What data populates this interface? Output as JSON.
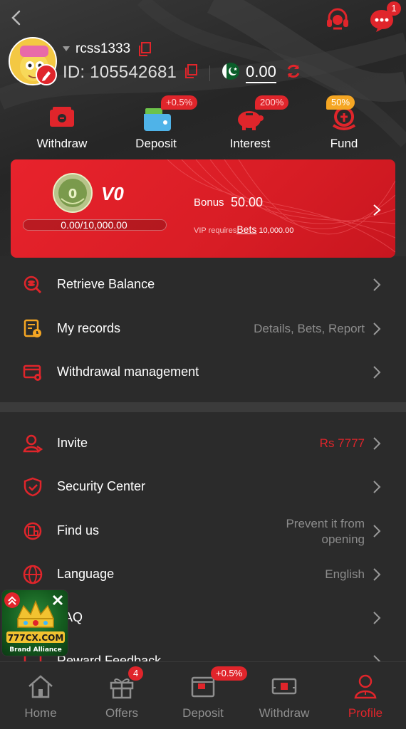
{
  "header": {
    "username": "rcss1333",
    "id_label": "ID:",
    "id_value": "105542681",
    "balance": "0.00",
    "message_count": "1"
  },
  "quick_actions": [
    {
      "label": "Withdraw",
      "badge": "",
      "icon": "withdraw-icon"
    },
    {
      "label": "Deposit",
      "badge": "+0.5%",
      "icon": "wallet-icon"
    },
    {
      "label": "Interest",
      "badge": "200%",
      "icon": "piggy-bank-icon"
    },
    {
      "label": "Fund",
      "badge": "50%",
      "icon": "fund-icon"
    }
  ],
  "vip": {
    "level": "V0",
    "medal_number": "0",
    "progress": "0.00/10,000.00",
    "progress_fraction": 0,
    "bonus_label": "Bonus",
    "bonus_value": "50.00",
    "requires_label": "VIP requires",
    "requires_link": "Bets",
    "requires_amount": "10,000.00"
  },
  "menu_top": [
    {
      "label": "Retrieve Balance",
      "value": "",
      "icon": "retrieve-balance-icon"
    },
    {
      "label": "My records",
      "value": "Details, Bets, Report",
      "icon": "records-icon"
    },
    {
      "label": "Withdrawal management",
      "value": "",
      "icon": "withdrawal-management-icon"
    }
  ],
  "menu_bottom": [
    {
      "label": "Invite",
      "value": "Rs 7777",
      "icon": "invite-icon"
    },
    {
      "label": "Security Center",
      "value": "",
      "icon": "shield-icon"
    },
    {
      "label": "Find us",
      "value_line1": "Prevent it from",
      "value_line2": "opening",
      "icon": "find-us-icon"
    },
    {
      "label": "Language",
      "value": "English",
      "icon": "globe-icon"
    },
    {
      "label": "FAQ",
      "value": "",
      "icon": "faq-icon"
    },
    {
      "label": "Reward Feedback",
      "value": "",
      "icon": "feedback-icon"
    }
  ],
  "promo": {
    "brand": "777CX.COM",
    "subtitle": "Brand Alliance"
  },
  "tabbar": [
    {
      "label": "Home",
      "badge": "",
      "icon": "home-icon"
    },
    {
      "label": "Offers",
      "badge": "4",
      "icon": "gift-icon"
    },
    {
      "label": "Deposit",
      "badge": "+0.5%",
      "icon": "deposit-icon"
    },
    {
      "label": "Withdraw",
      "badge": "",
      "icon": "withdraw-tab-icon"
    },
    {
      "label": "Profile",
      "badge": "",
      "icon": "profile-icon"
    }
  ],
  "colors": {
    "accent": "#e0252b",
    "background": "#2b2b2b",
    "badge_orange": "#f5a623",
    "muted_text": "#8c8c8c"
  }
}
